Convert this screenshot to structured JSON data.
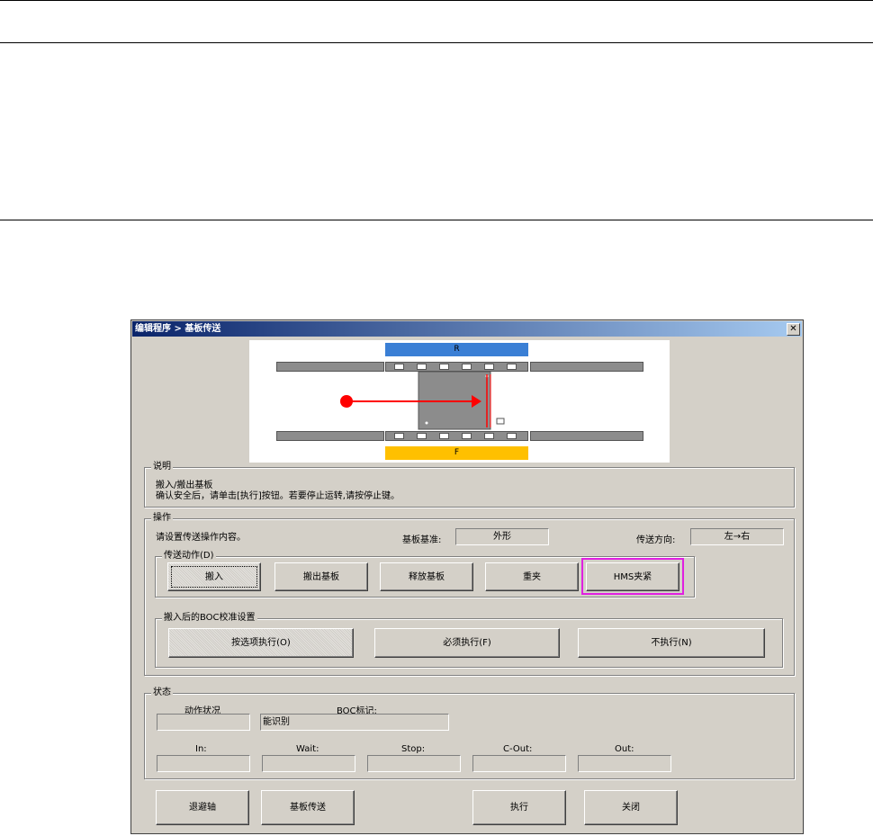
{
  "window": {
    "title": "编辑程序 > 基板传送",
    "close_glyph": "✕"
  },
  "diagram": {
    "rear_label": "R",
    "front_label": "F",
    "rear_color": "#3a7fd5",
    "front_color": "#ffc000",
    "arrow_color": "#ff0000"
  },
  "description": {
    "title": "说明",
    "line1": "搬入/搬出基板",
    "line2": "确认安全后，请单击[执行]按钮。若要停止运转,请按停止键。"
  },
  "operation": {
    "title": "操作",
    "prompt": "请设置传送操作内容。",
    "board_ref_label": "基板基准:",
    "board_ref_value": "外形",
    "direction_label": "传送方向:",
    "direction_value": "左→右",
    "transfer": {
      "title": "传送动作(D)",
      "buttons": [
        "搬入",
        "搬出基板",
        "释放基板",
        "重夹",
        "HMS夹紧"
      ]
    },
    "boc": {
      "title": "搬入后的BOC校准设置",
      "buttons": [
        "按选项执行(O)",
        "必须执行(F)",
        "不执行(N)"
      ]
    }
  },
  "status": {
    "title": "状态",
    "action_label": "动作状况",
    "action_value": "",
    "boc_mark_label": "BOC标记:",
    "boc_mark_value": "能识别",
    "sensors": [
      {
        "label": "In:",
        "value": ""
      },
      {
        "label": "Wait:",
        "value": ""
      },
      {
        "label": "Stop:",
        "value": ""
      },
      {
        "label": "C-Out:",
        "value": ""
      },
      {
        "label": "Out:",
        "value": ""
      }
    ]
  },
  "footer": {
    "buttons": [
      "退避轴",
      "基板传送",
      "执行",
      "关闭"
    ]
  }
}
